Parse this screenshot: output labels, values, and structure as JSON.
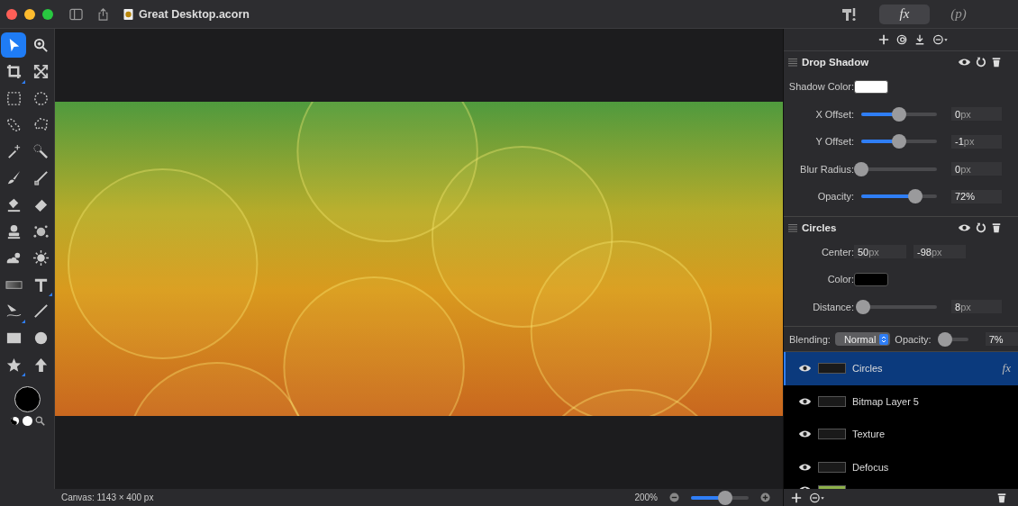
{
  "window": {
    "title": "Great Desktop.acorn"
  },
  "inspector_tabs": [
    {
      "kind": "tools",
      "selected": false
    },
    {
      "kind": "text",
      "label": "fx",
      "selected": true
    },
    {
      "kind": "text",
      "label": "(p)",
      "selected": false
    }
  ],
  "tools": [
    {
      "kind": "arrow",
      "selected": true,
      "submenu": false
    },
    {
      "kind": "zoom",
      "selected": false,
      "submenu": false
    },
    {
      "kind": "crop",
      "selected": false,
      "submenu": true
    },
    {
      "kind": "transform",
      "selected": false,
      "submenu": false
    },
    {
      "kind": "rect-select",
      "selected": false,
      "submenu": false
    },
    {
      "kind": "ellipse-select",
      "selected": false,
      "submenu": false
    },
    {
      "kind": "lasso",
      "selected": false,
      "submenu": false
    },
    {
      "kind": "polygon-lasso",
      "selected": false,
      "submenu": false
    },
    {
      "kind": "magic-wand",
      "selected": false,
      "submenu": false
    },
    {
      "kind": "selection-brush",
      "selected": false,
      "submenu": false
    },
    {
      "kind": "brush",
      "selected": false,
      "submenu": false
    },
    {
      "kind": "pencil",
      "selected": false,
      "submenu": false
    },
    {
      "kind": "fill",
      "selected": false,
      "submenu": false
    },
    {
      "kind": "eraser",
      "selected": false,
      "submenu": false
    },
    {
      "kind": "stamp",
      "selected": false,
      "submenu": false
    },
    {
      "kind": "splatter",
      "selected": false,
      "submenu": false
    },
    {
      "kind": "cloud-sun",
      "selected": false,
      "submenu": false
    },
    {
      "kind": "sun",
      "selected": false,
      "submenu": false
    },
    {
      "kind": "gradient",
      "selected": false,
      "submenu": false
    },
    {
      "kind": "text",
      "selected": false,
      "submenu": true
    },
    {
      "kind": "bezier",
      "selected": false,
      "submenu": true
    },
    {
      "kind": "line",
      "selected": false,
      "submenu": false
    },
    {
      "kind": "rectangle",
      "selected": false,
      "submenu": false
    },
    {
      "kind": "circle",
      "selected": false,
      "submenu": false
    },
    {
      "kind": "star",
      "selected": false,
      "submenu": true
    },
    {
      "kind": "up-arrow",
      "selected": false,
      "submenu": false
    }
  ],
  "filters": [
    {
      "title": "Drop Shadow",
      "params": [
        {
          "kind": "color",
          "label": "Shadow Color:",
          "color": "#ffffff"
        },
        {
          "kind": "slider",
          "label": "X Offset:",
          "level": 0.5,
          "value": "0",
          "unit": "px"
        },
        {
          "kind": "slider",
          "label": "Y Offset:",
          "level": 0.5,
          "value": "-1",
          "unit": "px"
        },
        {
          "kind": "slider",
          "label": "Blur Radius:",
          "level": 0.0,
          "value": "0",
          "unit": "px"
        },
        {
          "kind": "slider",
          "label": "Opacity:",
          "level": 0.72,
          "value": "72%"
        }
      ]
    },
    {
      "title": "Circles",
      "params": [
        {
          "kind": "pair",
          "label": "Center:",
          "values": [
            {
              "value": "50",
              "unit": "px"
            },
            {
              "value": "-98",
              "unit": "px"
            }
          ]
        },
        {
          "kind": "color",
          "label": "Color:",
          "color": "#000000"
        },
        {
          "kind": "slider",
          "label": "Distance:",
          "level": 0.02,
          "value": "8",
          "unit": "px"
        }
      ]
    }
  ],
  "layer_options": {
    "blending_label": "Blending:",
    "blending": "Normal",
    "opacity_label": "Opacity:",
    "opacity_slider": {
      "level": 0.07
    },
    "opacity": "7%"
  },
  "layers": [
    {
      "name": "Circles",
      "visible": true,
      "selected": true,
      "has_effects": true,
      "effects_mark": "fx"
    },
    {
      "name": "Bitmap Layer 5",
      "visible": true,
      "selected": false,
      "has_effects": false
    },
    {
      "name": "Texture",
      "visible": true,
      "selected": false,
      "has_effects": false
    },
    {
      "name": "Defocus",
      "visible": true,
      "selected": false,
      "has_effects": false
    }
  ],
  "cut_off_layer": {
    "visible": true
  },
  "status_bar": {
    "canvas_size": "Canvas: 1143 × 400 px",
    "zoom": "200%",
    "zoom_slider": {
      "level": 0.6
    }
  }
}
